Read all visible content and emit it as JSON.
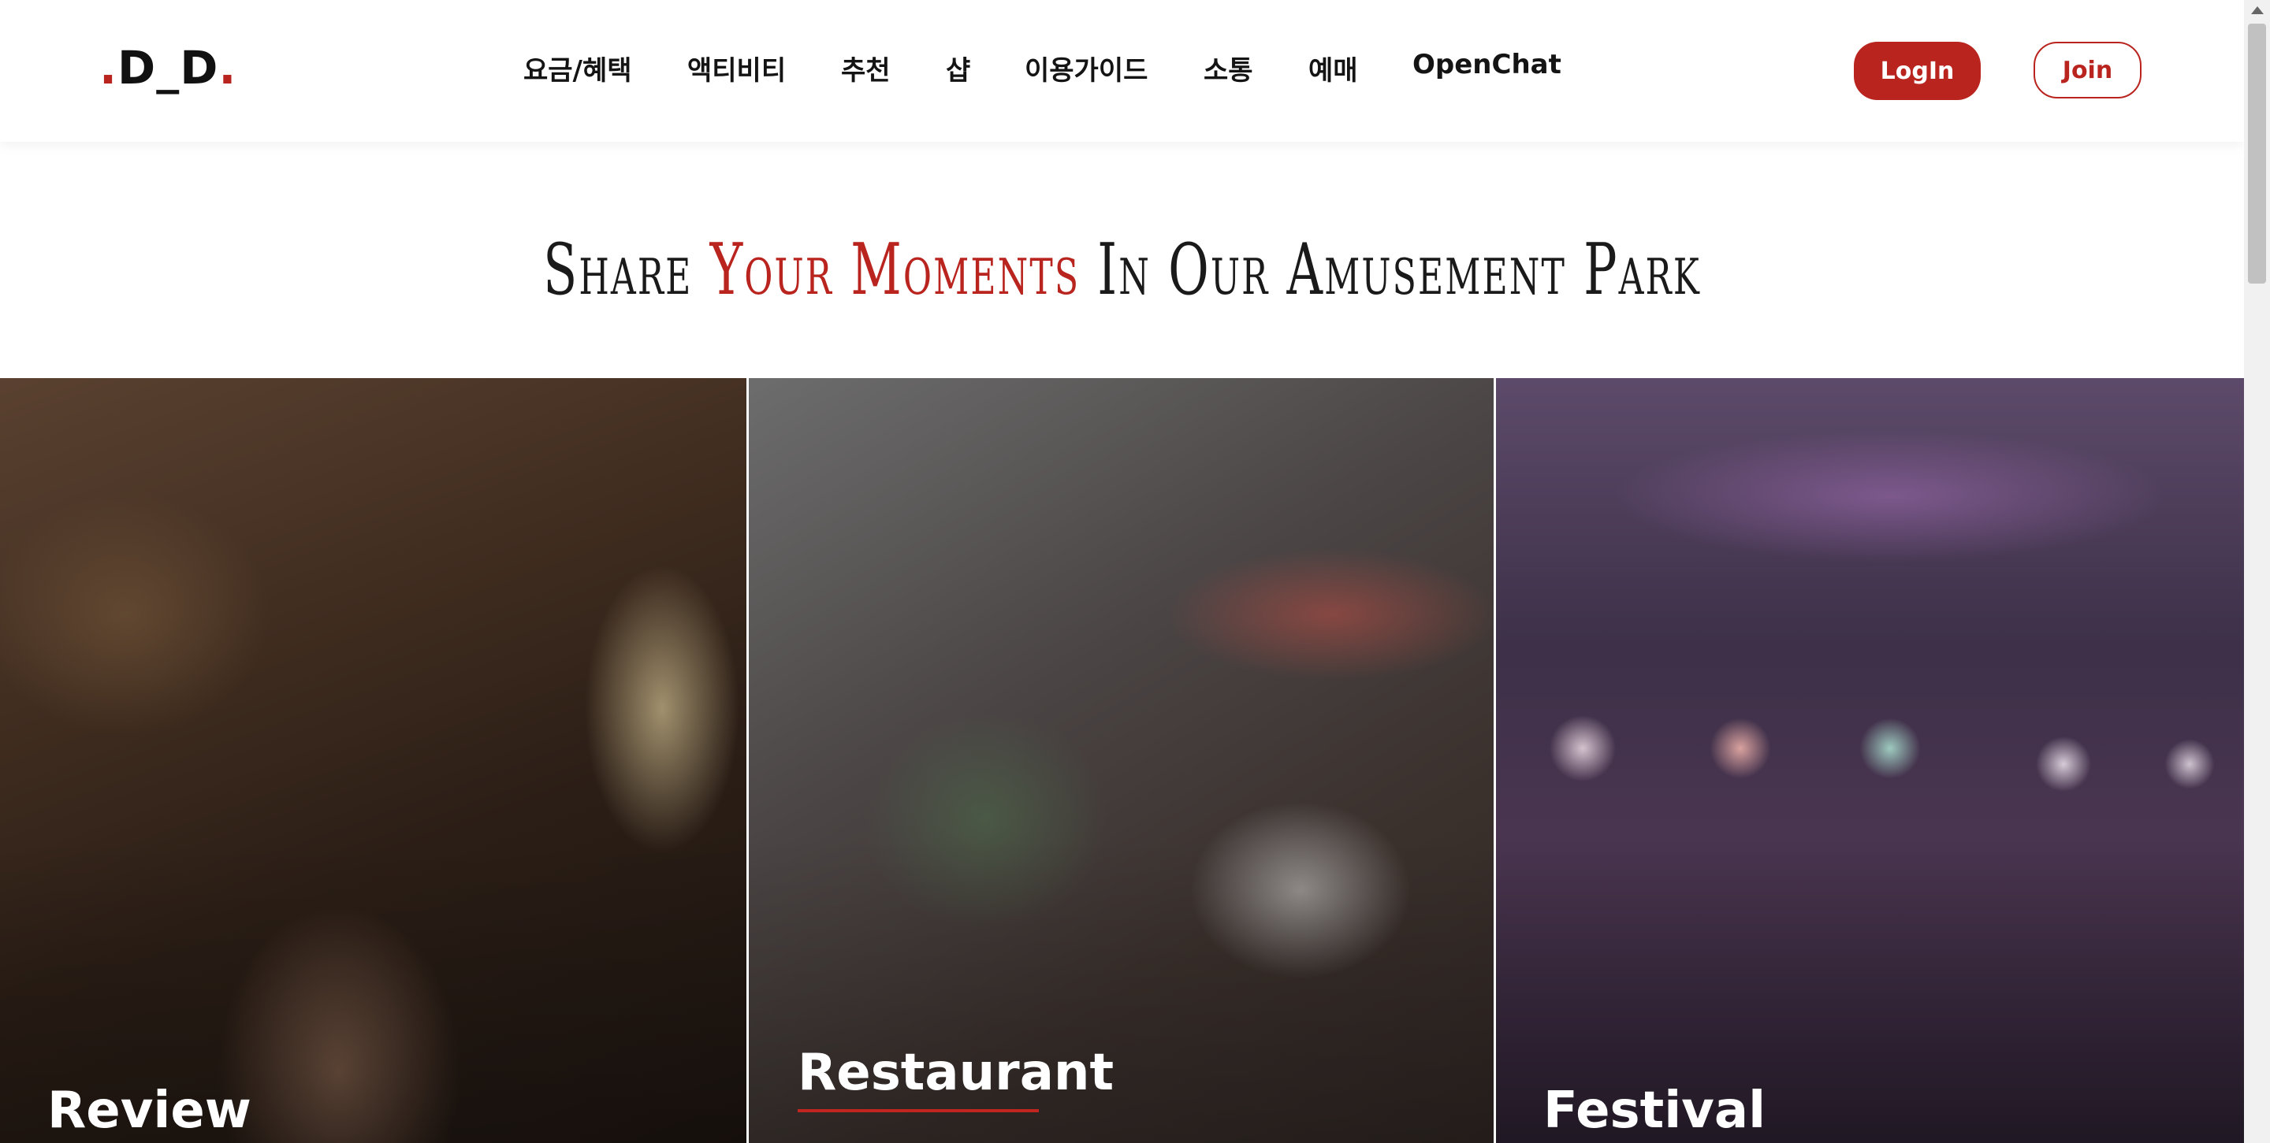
{
  "header": {
    "logo": {
      "dot_left": ".",
      "text": "D_D",
      "dot_right": "."
    },
    "nav": [
      {
        "label": "요금/혜택"
      },
      {
        "label": "액티비티"
      },
      {
        "label": "추천"
      },
      {
        "label": "샵"
      },
      {
        "label": "이용가이드"
      },
      {
        "label": "소통"
      },
      {
        "label": "예매"
      },
      {
        "label": "OpenChat"
      }
    ],
    "login_label": "LogIn",
    "join_label": "Join"
  },
  "hero": {
    "title_part1": "Share ",
    "title_accent": "Your Moments",
    "title_part2": " In Our Amusement Park"
  },
  "cards": [
    {
      "label": "Review"
    },
    {
      "label": "Restaurant",
      "underlined": true
    },
    {
      "label": "Festival"
    }
  ],
  "colors": {
    "accent": "#b9241f",
    "text": "#141414",
    "background": "#ffffff"
  }
}
